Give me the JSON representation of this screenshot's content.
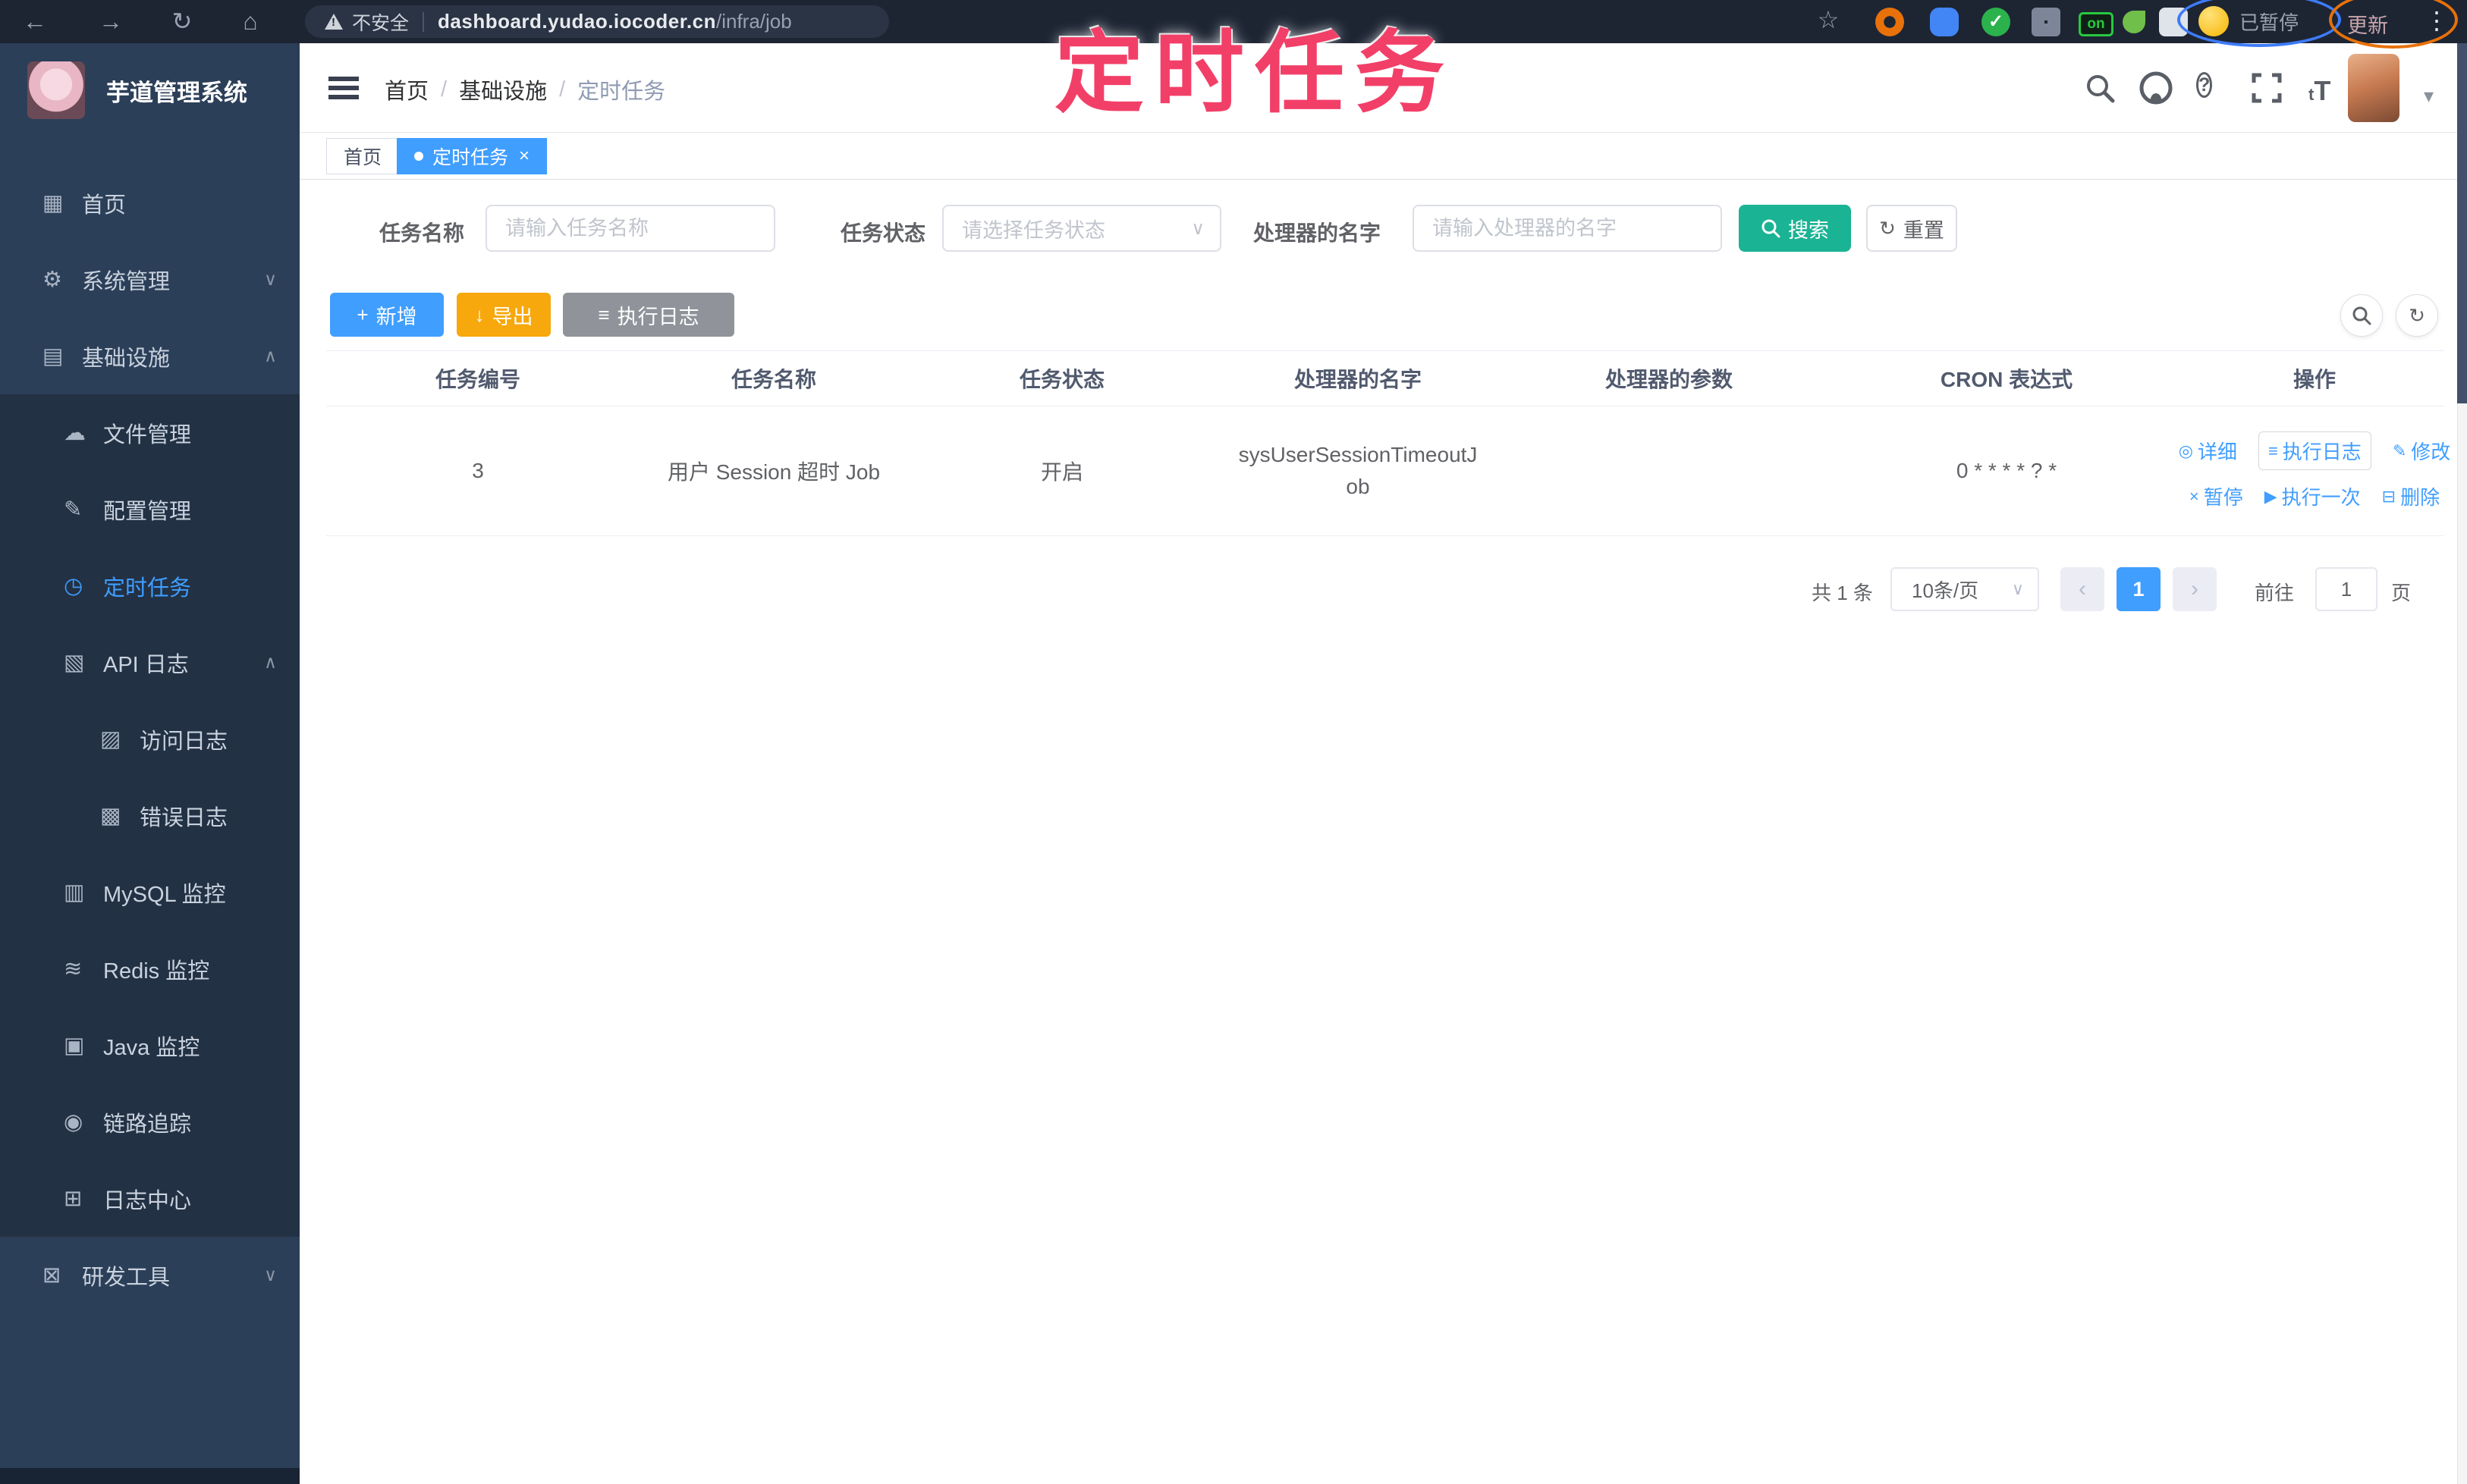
{
  "chrome": {
    "security_label": "不安全",
    "url_domain": "dashboard.yudao.iocoder.cn",
    "url_path": "/infra/job",
    "paused_badge": "已暂停",
    "update_button": "更新",
    "extension_on_badge": "on"
  },
  "annotation": {
    "title": "定时任务"
  },
  "sidebar": {
    "title": "芋道管理系统",
    "items": [
      {
        "label": "首页"
      },
      {
        "label": "系统管理"
      },
      {
        "label": "基础设施"
      },
      {
        "label": "文件管理"
      },
      {
        "label": "配置管理"
      },
      {
        "label": "定时任务"
      },
      {
        "label": "API 日志"
      },
      {
        "label": "访问日志"
      },
      {
        "label": "错误日志"
      },
      {
        "label": "MySQL 监控"
      },
      {
        "label": "Redis 监控"
      },
      {
        "label": "Java 监控"
      },
      {
        "label": "链路追踪"
      },
      {
        "label": "日志中心"
      },
      {
        "label": "研发工具"
      }
    ]
  },
  "breadcrumb": {
    "part1": "首页",
    "part2": "基础设施",
    "part3": "定时任务",
    "separator": "/"
  },
  "tabs": {
    "tab1": "首页",
    "tab2": "定时任务"
  },
  "filters": {
    "job_name_label": "任务名称",
    "job_name_placeholder": "请输入任务名称",
    "job_status_label": "任务状态",
    "job_status_placeholder": "请选择任务状态",
    "handler_name_label": "处理器的名字",
    "handler_name_placeholder": "请输入处理器的名字",
    "search_button": "搜索",
    "reset_button": "重置"
  },
  "toolbar": {
    "add_button": "新增",
    "export_button": "导出",
    "job_log_button": "执行日志"
  },
  "table": {
    "columns": [
      "任务编号",
      "任务名称",
      "任务状态",
      "处理器的名字",
      "处理器的参数",
      "CRON 表达式",
      "操作"
    ],
    "row": {
      "id": "3",
      "name": "用户 Session 超时 Job",
      "status": "开启",
      "handler_name": "sysUserSessionTimeoutJob",
      "handler_param": "",
      "cron": "0 * * * * ? *"
    },
    "actions": {
      "detail": "详细",
      "job_log": "执行日志",
      "edit": "修改",
      "pause": "暂停",
      "run_once": "执行一次",
      "delete": "删除"
    }
  },
  "pagination": {
    "total": "共 1 条",
    "page_size": "10条/页",
    "page": "1",
    "goto_label": "前往",
    "goto_value": "1",
    "goto_unit": "页"
  },
  "icons": {
    "back": "←",
    "forward": "→",
    "reload": "↻",
    "home": "⌂",
    "warning_mark": "!",
    "star": "☆",
    "kebab": "⋮",
    "chevron_down": "∨",
    "chevron_up": "∧",
    "caret_down": "▾",
    "question": "?",
    "text_small": "t",
    "text_big": "T",
    "plus": "+",
    "download": "↓",
    "list": "≡",
    "refresh": "↻",
    "detail": "◎",
    "edit": "✎",
    "pause": "×",
    "play": "▶",
    "trash": "⊟",
    "dot": "●",
    "close": "×",
    "prev": "‹",
    "next": "›",
    "menu_home": "▦",
    "menu_gear": "⚙",
    "menu_infra": "▤",
    "menu_cloud": "☁",
    "menu_config": "✎",
    "menu_timer": "◷",
    "menu_api": "▧",
    "menu_access": "▨",
    "menu_error": "▩",
    "menu_mysql": "▥",
    "menu_redis": "≋",
    "menu_java": "▣",
    "menu_trace": "◉",
    "menu_logcenter": "⊞",
    "menu_devtools": "⊠"
  },
  "colors": {
    "accent": "#409eff",
    "search_green": "#1ab394",
    "export_orange": "#f7a80d",
    "info_gray": "#909399",
    "annotation_pink": "#f23f68",
    "sidebar_bg": "#2c3f58"
  }
}
